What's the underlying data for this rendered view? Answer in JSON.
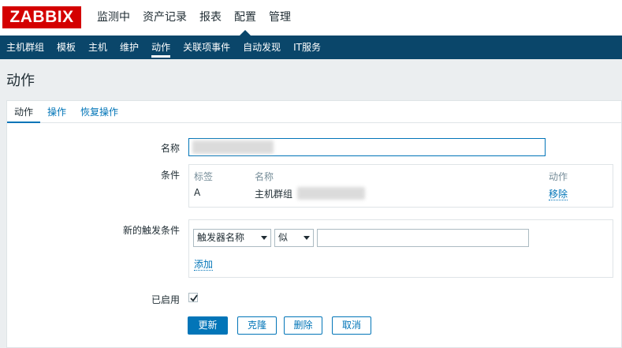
{
  "header": {
    "logo": "ZABBIX",
    "main_menu": [
      "监测中",
      "资产记录",
      "报表",
      "配置",
      "管理"
    ],
    "active_main": "配置"
  },
  "submenu": {
    "items": [
      "主机群组",
      "模板",
      "主机",
      "维护",
      "动作",
      "关联项事件",
      "自动发现",
      "IT服务"
    ],
    "active": "动作"
  },
  "page": {
    "title": "动作"
  },
  "tabs": [
    {
      "label": "动作",
      "active": true
    },
    {
      "label": "操作",
      "active": false
    },
    {
      "label": "恢复操作",
      "active": false
    }
  ],
  "form": {
    "name_label": "名称",
    "name_value": "",
    "conditions_label": "条件",
    "conditions_table": {
      "headers": {
        "tag": "标签",
        "name": "名称",
        "action": "动作"
      },
      "rows": [
        {
          "tag": "A",
          "name": "主机群组",
          "action": "移除"
        }
      ]
    },
    "new_condition_label": "新的触发条件",
    "new_condition": {
      "type_select": "触发器名称",
      "operator_select": "似",
      "value": "",
      "add_link": "添加"
    },
    "enabled_label": "已启用",
    "enabled": true
  },
  "buttons": {
    "update": "更新",
    "clone": "克隆",
    "delete": "删除",
    "cancel": "取消"
  },
  "colors": {
    "brand_red": "#d40000",
    "nav_dark": "#0a466a",
    "link_blue": "#0275b8"
  }
}
